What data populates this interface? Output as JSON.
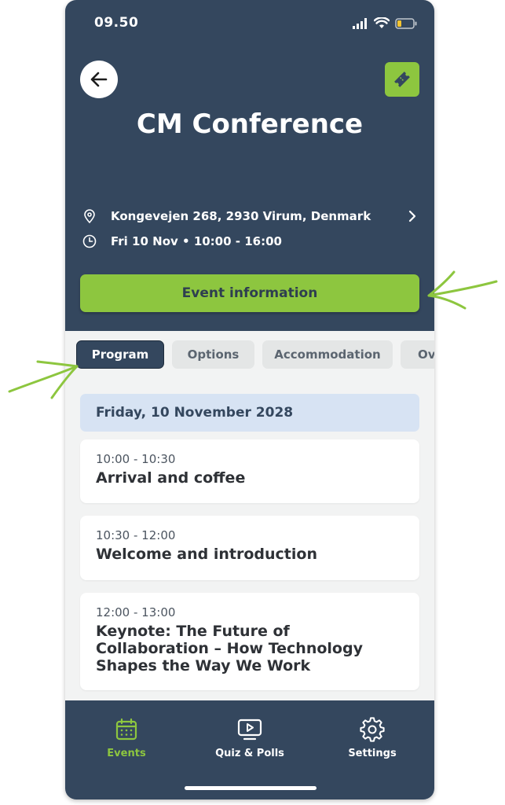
{
  "status": {
    "time": "09.50"
  },
  "event": {
    "title": "CM Conference",
    "location": "Kongevejen 268, 2930 Virum, Denmark",
    "datetime": "Fri 10 Nov • 10:00 - 16:00",
    "info_button": "Event information"
  },
  "tabs": [
    {
      "label": "Program",
      "active": true
    },
    {
      "label": "Options",
      "active": false
    },
    {
      "label": "Accommodation",
      "active": false
    },
    {
      "label": "Ov",
      "active": false
    }
  ],
  "program": {
    "date": "Friday, 10 November 2028",
    "sessions": [
      {
        "time": "10:00 - 10:30",
        "title": "Arrival and coffee"
      },
      {
        "time": "10:30 - 12:00",
        "title": "Welcome and introduction"
      },
      {
        "time": "12:00 - 13:00",
        "title": "Keynote: The Future of Collaboration – How Technology Shapes the Way We Work"
      }
    ]
  },
  "nav": [
    {
      "label": "Events",
      "icon": "calendar-icon",
      "active": true
    },
    {
      "label": "Quiz & Polls",
      "icon": "play-screen-icon",
      "active": false
    },
    {
      "label": "Settings",
      "icon": "gear-icon",
      "active": false
    }
  ],
  "colors": {
    "header_bg": "#34475e",
    "accent_green": "#8dc63f",
    "date_bar_bg": "#d7e3f3",
    "content_bg": "#f2f3f3",
    "annotation_arrow": "#8dc63f"
  }
}
